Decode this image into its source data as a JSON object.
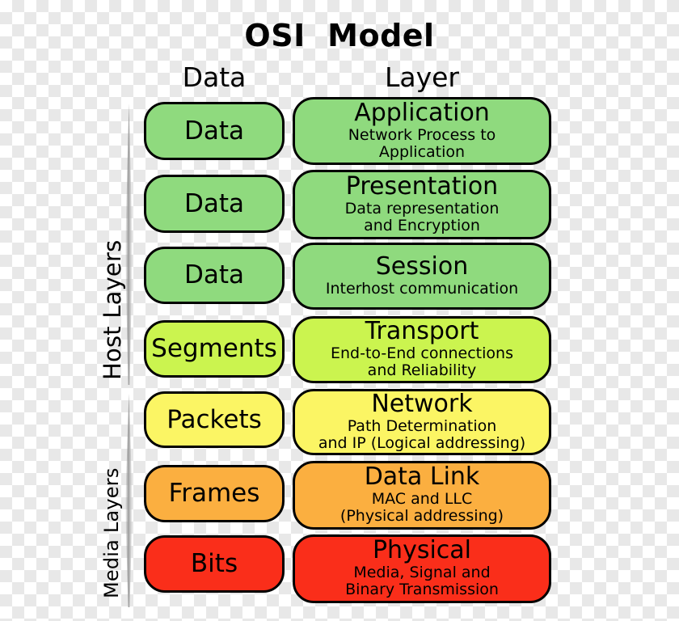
{
  "title": "OSI  Model",
  "columns": {
    "data_header": "Data",
    "layer_header": "Layer"
  },
  "groups": [
    {
      "id": "host",
      "label": "Host Layers"
    },
    {
      "id": "media",
      "label": "Media Layers"
    }
  ],
  "colors": {
    "green": "#8FDA7E",
    "yellow_green": "#CBF44F",
    "yellow": "#FBF564",
    "orange": "#FBAF40",
    "red": "#FA2E1A",
    "border": "#000000",
    "background_light": "#FFFFFF",
    "background_dark": "#E8E8E8"
  },
  "rows": [
    {
      "pdu": "Data",
      "layer_name": "Application",
      "layer_desc": "Network Process to\nApplication",
      "color": "#8FDA7E",
      "group": "host"
    },
    {
      "pdu": "Data",
      "layer_name": "Presentation",
      "layer_desc": "Data representation\nand Encryption",
      "color": "#8FDA7E",
      "group": "host"
    },
    {
      "pdu": "Data",
      "layer_name": "Session",
      "layer_desc": "Interhost communication",
      "color": "#8FDA7E",
      "group": "host"
    },
    {
      "pdu": "Segments",
      "layer_name": "Transport",
      "layer_desc": "End-to-End connections\nand Reliability",
      "color": "#CBF44F",
      "group": "host"
    },
    {
      "pdu": "Packets",
      "layer_name": "Network",
      "layer_desc": "Path Determination\nand IP (Logical addressing)",
      "color": "#FBF564",
      "group": "media"
    },
    {
      "pdu": "Frames",
      "layer_name": "Data Link",
      "layer_desc": "MAC and LLC\n(Physical addressing)",
      "color": "#FBAF40",
      "group": "media"
    },
    {
      "pdu": "Bits",
      "layer_name": "Physical",
      "layer_desc": "Media, Signal and\nBinary Transmission",
      "color": "#FA2E1A",
      "group": "media"
    }
  ]
}
